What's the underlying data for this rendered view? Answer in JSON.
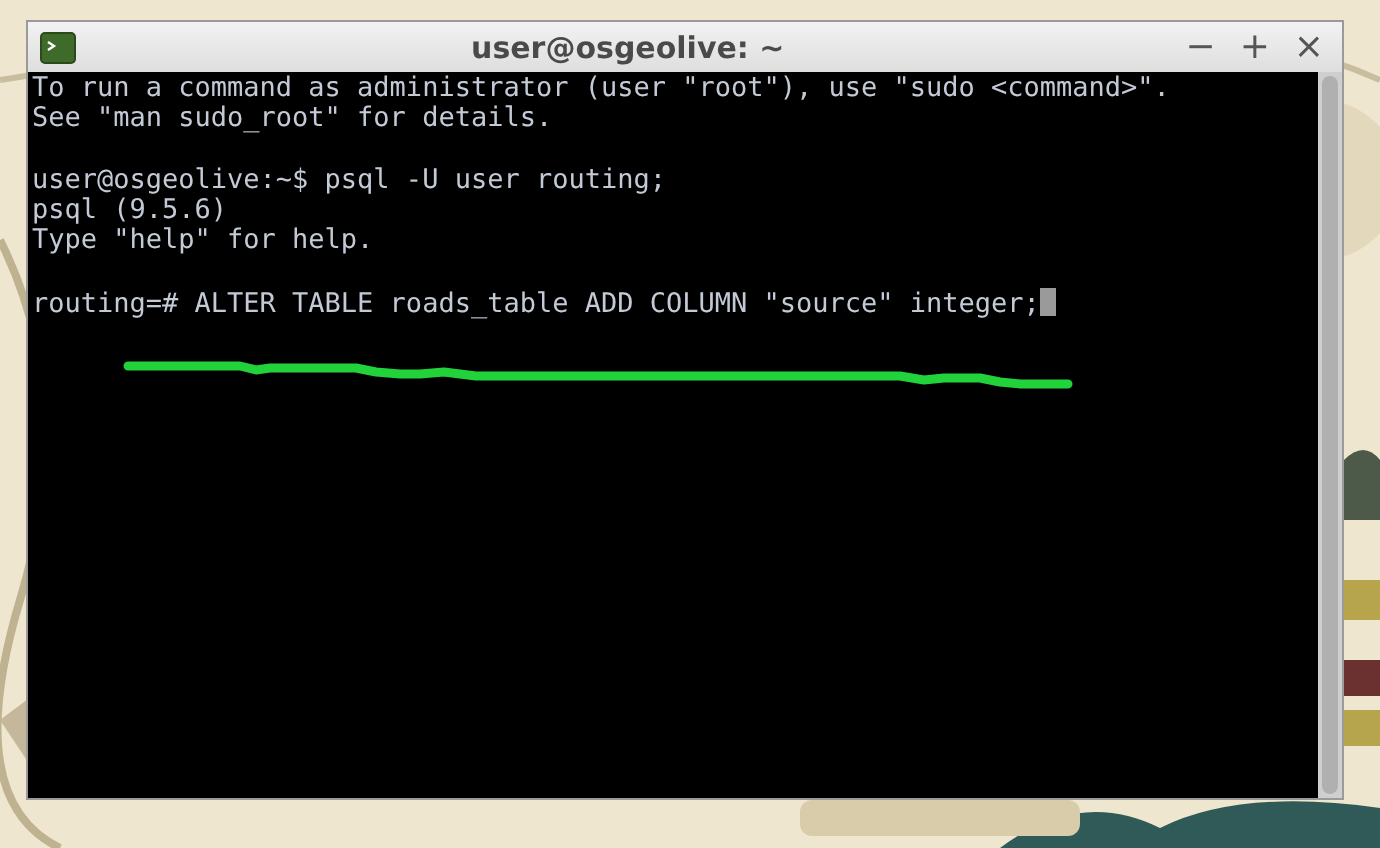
{
  "window": {
    "title": "user@osgeolive: ~",
    "controls": [
      "−",
      "+",
      "×"
    ]
  },
  "terminal": {
    "blocks": [
      [
        "To run a command as administrator (user \"root\"), use \"sudo <command>\".",
        "See \"man sudo_root\" for details."
      ],
      [
        "user@osgeolive:~$ psql -U user routing;",
        "psql (9.5.6)",
        "Type \"help\" for help."
      ],
      [
        "routing=# ALTER TABLE roads_table ADD COLUMN \"source\" integer;"
      ]
    ],
    "cursor": true
  }
}
